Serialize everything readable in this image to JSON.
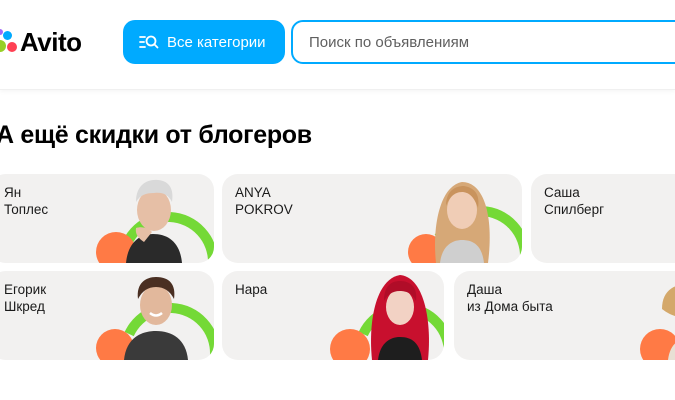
{
  "header": {
    "logo_text": "Avito",
    "categories_label": "Все категории",
    "search_placeholder": "Поиск по объявлениям"
  },
  "section": {
    "title": "А ещё скидки от блогеров"
  },
  "bloggers": [
    {
      "line1": "Ян",
      "line2": "Топлес"
    },
    {
      "line1": "ANYA",
      "line2": "POKROV"
    },
    {
      "line1": "Саша",
      "line2": "Спилберг"
    },
    {
      "line1": "Егорик",
      "line2": "Шкред"
    },
    {
      "line1": "Нара",
      "line2": ""
    },
    {
      "line1": "Даша",
      "line2": "из Дома быта"
    }
  ],
  "colors": {
    "accent_blue": "#00aaff",
    "card_bg": "#f2f1f0",
    "green": "#74d936",
    "orange": "#ff7a45",
    "logo_blue": "#0af",
    "logo_green": "#97cf26",
    "logo_red": "#ff4053",
    "logo_purple": "#a169f7"
  }
}
